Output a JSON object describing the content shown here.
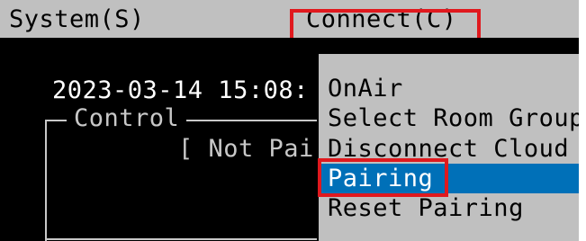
{
  "menubar": {
    "system_label": "System(S)",
    "connect_label": "Connect(C)"
  },
  "terminal": {
    "datetime": "2023-03-14 15:08:",
    "control_title": "Control",
    "pairing_status": "[ Not Pai"
  },
  "dropdown": {
    "items": [
      {
        "label": "OnAir",
        "selected": false
      },
      {
        "label": "Select Room Group",
        "selected": false
      },
      {
        "label": "Disconnect Cloud",
        "selected": false
      },
      {
        "label": "Pairing",
        "selected": true
      },
      {
        "label": "Reset Pairing",
        "selected": false
      }
    ]
  },
  "colors": {
    "menubar_bg": "#c0c0c0",
    "terminal_bg": "#000000",
    "selection_bg": "#0070b8",
    "highlight_box": "#e0191e"
  }
}
